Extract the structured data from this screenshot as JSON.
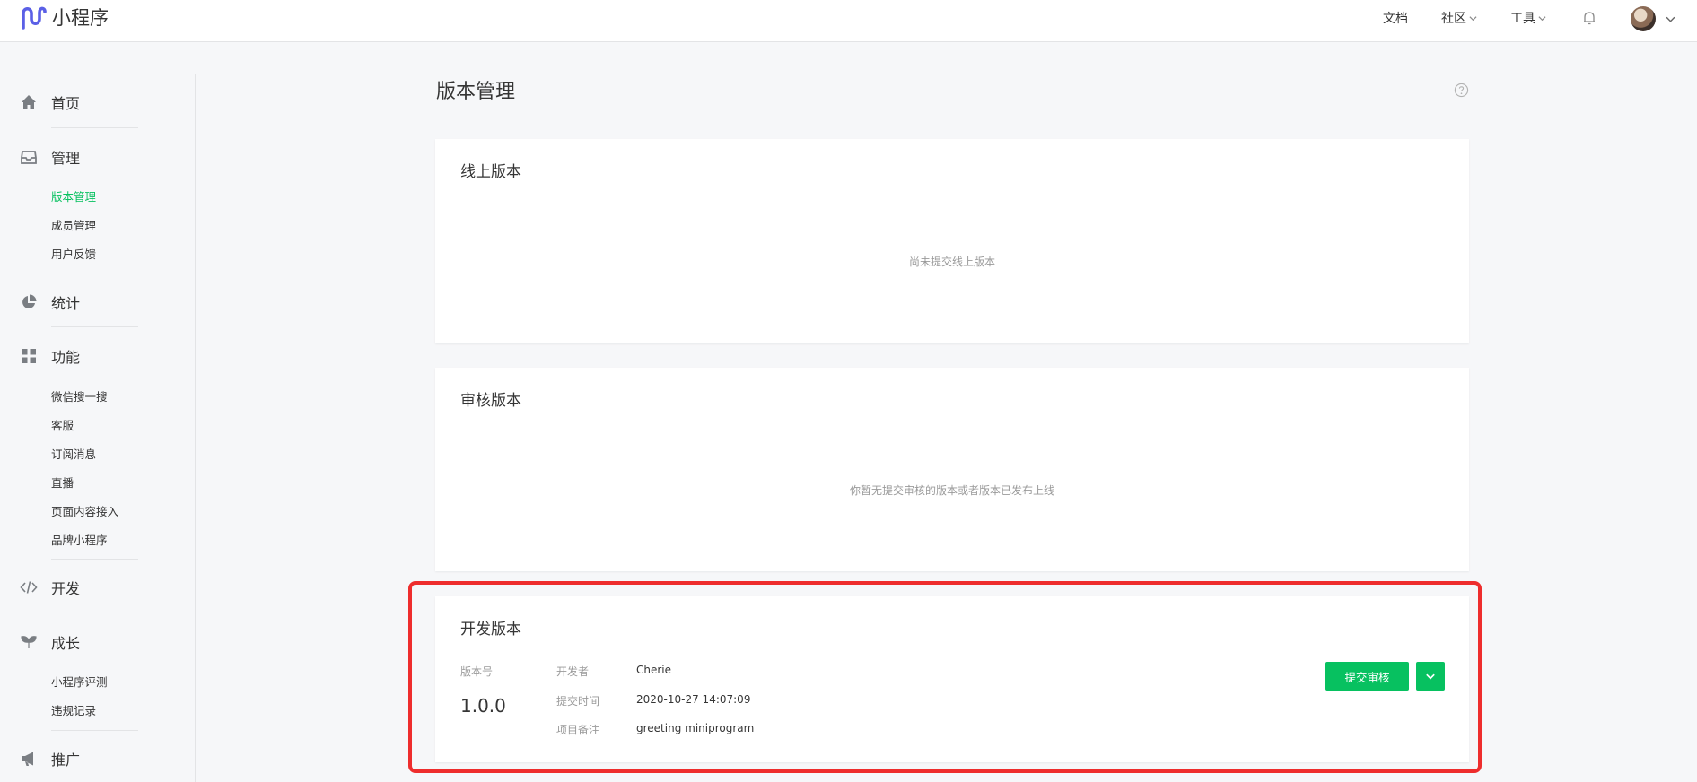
{
  "app": {
    "title": "小程序"
  },
  "topnav": {
    "docs": "文档",
    "community": "社区",
    "tools": "工具"
  },
  "sidebar": {
    "home": "首页",
    "manage": "管理",
    "manage_items": [
      "版本管理",
      "成员管理",
      "用户反馈"
    ],
    "stats": "统计",
    "features": "功能",
    "features_items": [
      "微信搜一搜",
      "客服",
      "订阅消息",
      "直播",
      "页面内容接入",
      "品牌小程序"
    ],
    "develop": "开发",
    "growth": "成长",
    "growth_items": [
      "小程序评测",
      "违规记录"
    ],
    "promote": "推广"
  },
  "page": {
    "title": "版本管理"
  },
  "online": {
    "title": "线上版本",
    "empty": "尚未提交线上版本"
  },
  "review": {
    "title": "审核版本",
    "empty": "你暂无提交审核的版本或者版本已发布上线"
  },
  "dev": {
    "title": "开发版本",
    "version_label": "版本号",
    "version": "1.0.0",
    "developer_label": "开发者",
    "developer": "Cherie",
    "time_label": "提交时间",
    "time": "2020-10-27 14:07:09",
    "note_label": "项目备注",
    "note": "greeting miniprogram",
    "submit_button": "提交审核"
  },
  "colors": {
    "accent": "#07c160",
    "highlight": "#ee2d2d"
  }
}
